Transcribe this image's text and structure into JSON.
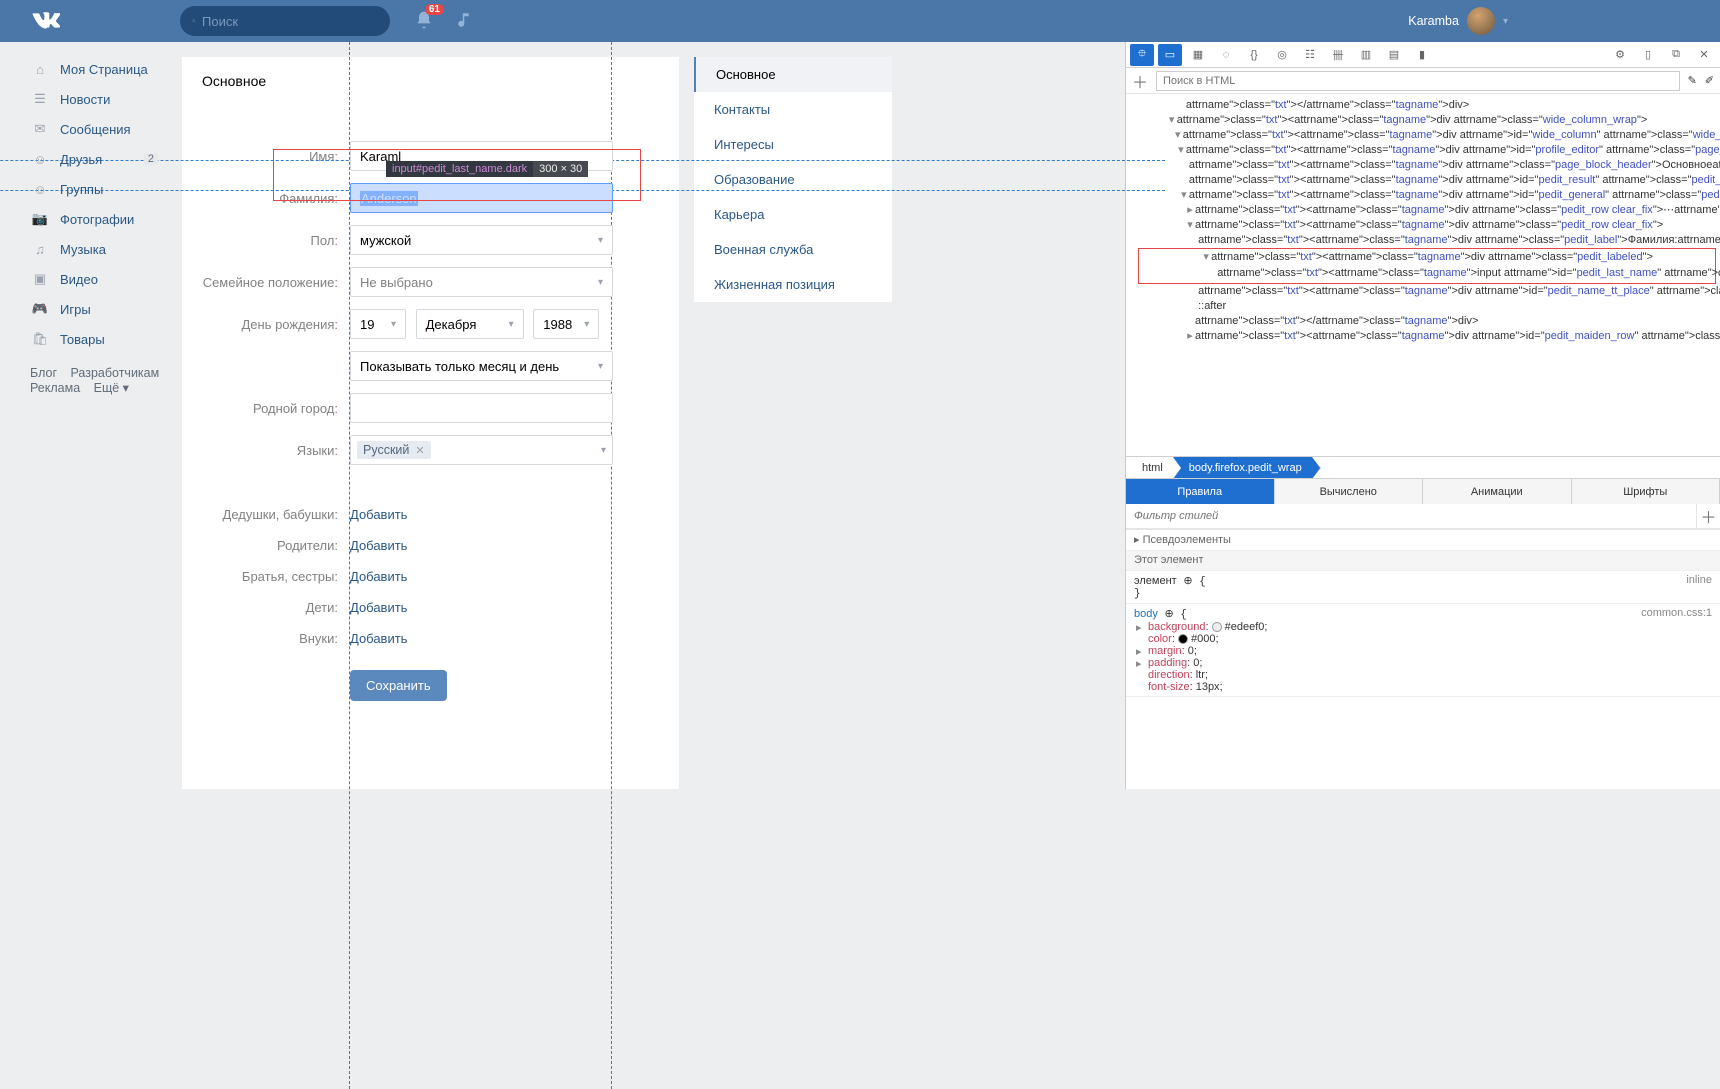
{
  "header": {
    "search_placeholder": "Поиск",
    "notif_count": "61",
    "username": "Karamba"
  },
  "nav": {
    "items": [
      {
        "icon": "home",
        "label": "Моя Страница"
      },
      {
        "icon": "news",
        "label": "Новости"
      },
      {
        "icon": "msg",
        "label": "Сообщения"
      },
      {
        "icon": "friends",
        "label": "Друзья",
        "count": "2"
      },
      {
        "icon": "groups",
        "label": "Группы"
      },
      {
        "icon": "photos",
        "label": "Фотографии"
      },
      {
        "icon": "music",
        "label": "Музыка"
      },
      {
        "icon": "video",
        "label": "Видео"
      },
      {
        "icon": "games",
        "label": "Игры"
      },
      {
        "icon": "market",
        "label": "Товары"
      }
    ],
    "footer": [
      "Блог",
      "Разработчикам",
      "Реклама",
      "Ещё ▾"
    ]
  },
  "form": {
    "header": "Основное",
    "labels": {
      "first_name": "Имя:",
      "last_name": "Фамилия:",
      "sex": "Пол:",
      "marital": "Семейное положение:",
      "bday": "День рождения:",
      "hometown": "Родной город:",
      "langs": "Языки:",
      "grandparents": "Дедушки, бабушки:",
      "parents": "Родители:",
      "siblings": "Братья, сестры:",
      "children": "Дети:",
      "grandchildren": "Внуки:"
    },
    "values": {
      "first_name": "Karaml",
      "last_name": "Anderson",
      "sex": "мужской",
      "marital": "Не выбрано",
      "bday_day": "19",
      "bday_month": "Декабря",
      "bday_year": "1988",
      "bday_show": "Показывать только месяц и день",
      "lang_tag": "Русский",
      "add": "Добавить",
      "save": "Сохранить"
    },
    "inspect_tip": {
      "selector": "input#pedit_last_name.dark",
      "dim": "300 × 30"
    }
  },
  "side_tabs": [
    "Основное",
    "Контакты",
    "Интересы",
    "Образование",
    "Карьера",
    "Военная служба",
    "Жизненная позиция"
  ],
  "devtools": {
    "search_placeholder": "Поиск в HTML",
    "crumbs": [
      "html",
      "body.firefox.pedit_wrap"
    ],
    "sub_tabs": [
      "Правила",
      "Вычислено",
      "Анимации",
      "Шрифты"
    ],
    "filter_placeholder": "Фильтр стилей",
    "pseudo": "Псевдоэлементы",
    "this_el": "Этот элемент",
    "inline_label": "inline",
    "element_label": "элемент",
    "body_label": "body",
    "common_src": "common.css:1",
    "body_rules": [
      {
        "name": "background",
        "value": "#edeef0",
        "swatch": "#edeef0",
        "tw": true
      },
      {
        "name": "color",
        "value": "#000",
        "swatch": "#000"
      },
      {
        "name": "margin",
        "value": "0",
        "tw": true
      },
      {
        "name": "padding",
        "value": "0",
        "tw": true
      },
      {
        "name": "direction",
        "value": "ltr"
      },
      {
        "name": "font-size",
        "value": "13px"
      }
    ],
    "tree": [
      {
        "ind": 11,
        "html": "</div>"
      },
      {
        "ind": 9,
        "tw": "▾",
        "html": "<div class=\"wide_column_wrap\">"
      },
      {
        "ind": 10,
        "tw": "▾",
        "html": "<div id=\"wide_column\" class=\"wide_column\">"
      },
      {
        "ind": 11,
        "tw": "▾",
        "html": "<div id=\"profile_editor\" class=\"page_block clear_fix\">"
      },
      {
        "ind": 12,
        "html": "<div class=\"page_block_header\">Основное</div>"
      },
      {
        "ind": 12,
        "html": "<div id=\"pedit_result\" class=\"pedit_result\"></div>"
      },
      {
        "ind": 12,
        "tw": "▾",
        "html": "<div id=\"pedit_general\" class=\"pedit_content\">"
      },
      {
        "ind": 13,
        "tw": "▸",
        "html": "<div class=\"pedit_row clear_fix\">⋯</div>"
      },
      {
        "ind": 13,
        "tw": "▾",
        "html": "<div class=\"pedit_row clear_fix\">"
      },
      {
        "ind": 14,
        "html": "<div class=\"pedit_label\">Фамилия:</div>"
      }
    ],
    "tree_highlight": [
      {
        "ind": 14,
        "tw": "▾",
        "html": "<div class=\"pedit_labeled\">"
      },
      {
        "ind": 15,
        "html": "<input id=\"pedit_last_name\" class=\"dark\" value=\"Anderson\" autocomplete=\"off\" type=\"text\">",
        "ev": true
      }
    ],
    "tree_after": [
      {
        "ind": 14,
        "html": "<div id=\"pedit_name_tt_place\" class=\"fl_l\"></div>"
      },
      {
        "ind": 14,
        "html": "::after"
      },
      {
        "ind": 13,
        "html": "</div>"
      },
      {
        "ind": 13,
        "tw": "▸",
        "html": "<div id=\"pedit_maiden_row\" class=\"pedit_row clear_fix\""
      }
    ]
  }
}
